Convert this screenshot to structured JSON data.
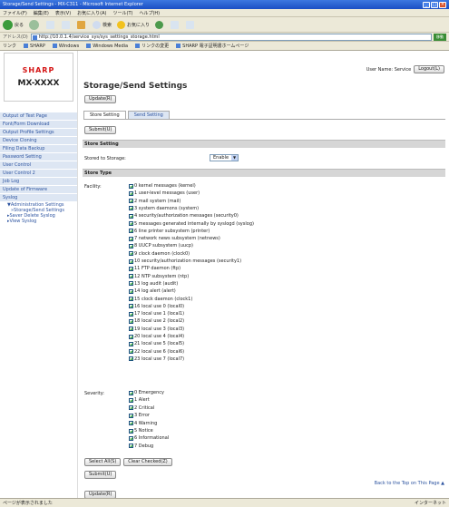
{
  "window": {
    "title": "Storage/Send Settings - MX-C311 - Microsoft Internet Explorer"
  },
  "menu": [
    "ファイル(F)",
    "編集(E)",
    "表示(V)",
    "お気に入り(A)",
    "ツール(T)",
    "ヘルプ(H)"
  ],
  "toolbar": {
    "back": "戻る",
    "search": "検索",
    "favorites": "お気に入り"
  },
  "address": {
    "label": "アドレス(D)",
    "url": "http://10.0.1.4/service_sys/sys_settings_storage.html",
    "go": "移動"
  },
  "links": {
    "label": "リンク",
    "items": [
      "SHARP",
      "Windows",
      "Windows Media",
      "リンクの変更",
      "SHARP 電子証明書ホームページ"
    ]
  },
  "logo": {
    "brand": "SHARP",
    "model": "MX-XXXX"
  },
  "nav": {
    "items": [
      "Output of Test Page",
      "Font/Form Download",
      "Output Profile Settings",
      "Device Cloning",
      "Filing Data Backup",
      "Password Setting",
      "User Control",
      "User Control 2",
      "Job Log",
      "Update of Firmware",
      "Syslog"
    ],
    "sub": [
      "▼Administration Settings",
      "»Storage/Send Settings",
      "▸Saver Delete Syslog",
      "▸View Syslog"
    ]
  },
  "user": {
    "label": "User Name: Service",
    "logout": "Logout(L)"
  },
  "page": {
    "title": "Storage/Send Settings",
    "update_btn": "Update(R)",
    "submit_btn": "Submit(U)"
  },
  "tabs": [
    "Store Setting",
    "Send Setting"
  ],
  "store_setting": {
    "header": "Store Setting",
    "label": "Stored to Storage:",
    "value": "Enable"
  },
  "store_type": {
    "header": "Store Type",
    "facility_label": "Facility:",
    "severity_label": "Severity:"
  },
  "facility": [
    "0 kernel messages (kernel)",
    "1 user-level messages (user)",
    "2 mail system (mail)",
    "3 system daemons (system)",
    "4 security/authorization messages (security0)",
    "5 messages generated internally by syslogd (syslog)",
    "6 line printer subsystem (printer)",
    "7 network news subsystem (netnews)",
    "8 UUCP subsystem (uucp)",
    "9 clock daemon (clock0)",
    "10 security/authorization messages (security1)",
    "11 FTP daemon (ftp)",
    "12 NTP subsystem (ntp)",
    "13 log audit (audit)",
    "14 log alert (alert)",
    "15 clock daemon (clock1)",
    "16 local use 0 (local0)",
    "17 local use 1 (local1)",
    "18 local use 2 (local2)",
    "19 local use 3 (local3)",
    "20 local use 4 (local4)",
    "21 local use 5 (local5)",
    "22 local use 6 (local6)",
    "23 local use 7 (local7)"
  ],
  "severity": [
    "0 Emergency",
    "1 Alert",
    "2 Critical",
    "3 Error",
    "4 Warning",
    "5 Notice",
    "6 Informational",
    "7 Debug"
  ],
  "actions": {
    "select_all": "Select All(S)",
    "clear_checked": "Clear Checked(Z)"
  },
  "footer": {
    "back_to_top": "Back to the Top on This Page ▲"
  },
  "status": {
    "left": "ページが表示されました",
    "right": "インターネット"
  }
}
